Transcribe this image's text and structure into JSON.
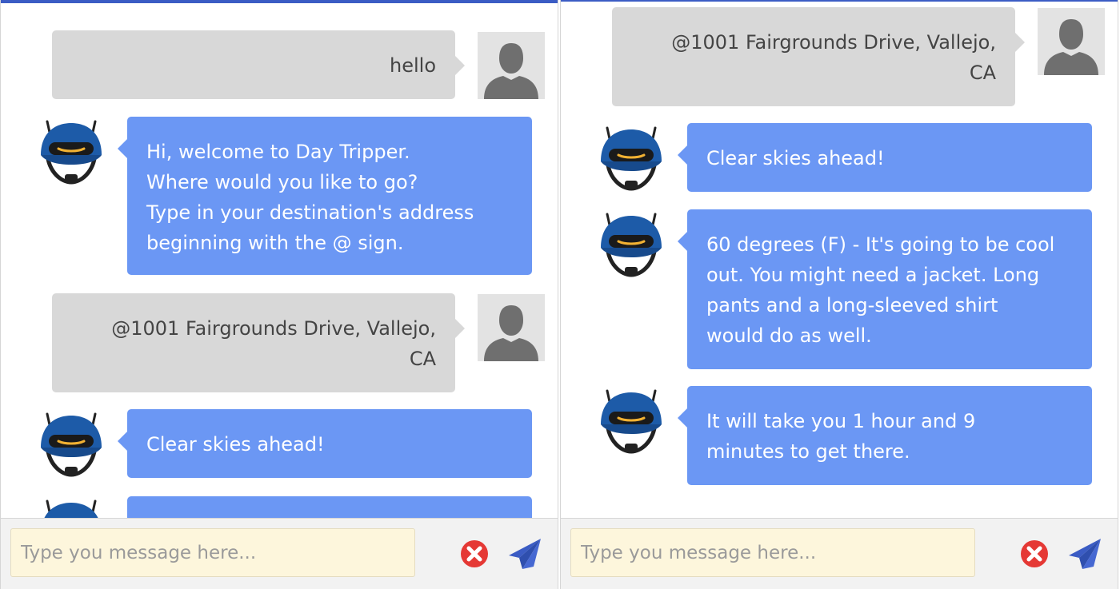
{
  "colors": {
    "accent": "#3b5cc4",
    "bot_bubble": "#6b97f4",
    "user_bubble": "#d8d8d8",
    "input_bg": "#fdf6dc",
    "clear_icon": "#e53935",
    "send_icon": "#3b5cc4"
  },
  "icons": {
    "user_avatar": "user-silhouette-icon",
    "bot_avatar": "robot-helmet-icon",
    "clear": "close-circle-icon",
    "send": "paper-plane-icon"
  },
  "left": {
    "messages": [
      {
        "sender": "user",
        "lines": [
          "hello"
        ]
      },
      {
        "sender": "bot",
        "lines": [
          "Hi, welcome to Day Tripper.",
          "Where would you like to go?",
          "Type in your destination's address",
          "beginning with the @ sign."
        ]
      },
      {
        "sender": "user",
        "lines": [
          "@1001 Fairgrounds Drive, Vallejo,",
          "CA"
        ]
      },
      {
        "sender": "bot",
        "lines": [
          "Clear skies ahead!"
        ]
      }
    ],
    "composer": {
      "placeholder": "Type you message here...",
      "value": ""
    }
  },
  "right": {
    "messages": [
      {
        "sender": "user",
        "lines": [
          "@1001 Fairgrounds Drive, Vallejo,",
          "CA"
        ]
      },
      {
        "sender": "bot",
        "lines": [
          "Clear skies ahead!"
        ]
      },
      {
        "sender": "bot",
        "lines": [
          "60 degrees (F) - It's going to be cool",
          "out. You might need a jacket. Long",
          "pants and a long-sleeved shirt",
          "would do as well."
        ]
      },
      {
        "sender": "bot",
        "lines": [
          "It will take you 1 hour and 9",
          "minutes to get there."
        ]
      }
    ],
    "composer": {
      "placeholder": "Type you message here...",
      "value": ""
    }
  }
}
